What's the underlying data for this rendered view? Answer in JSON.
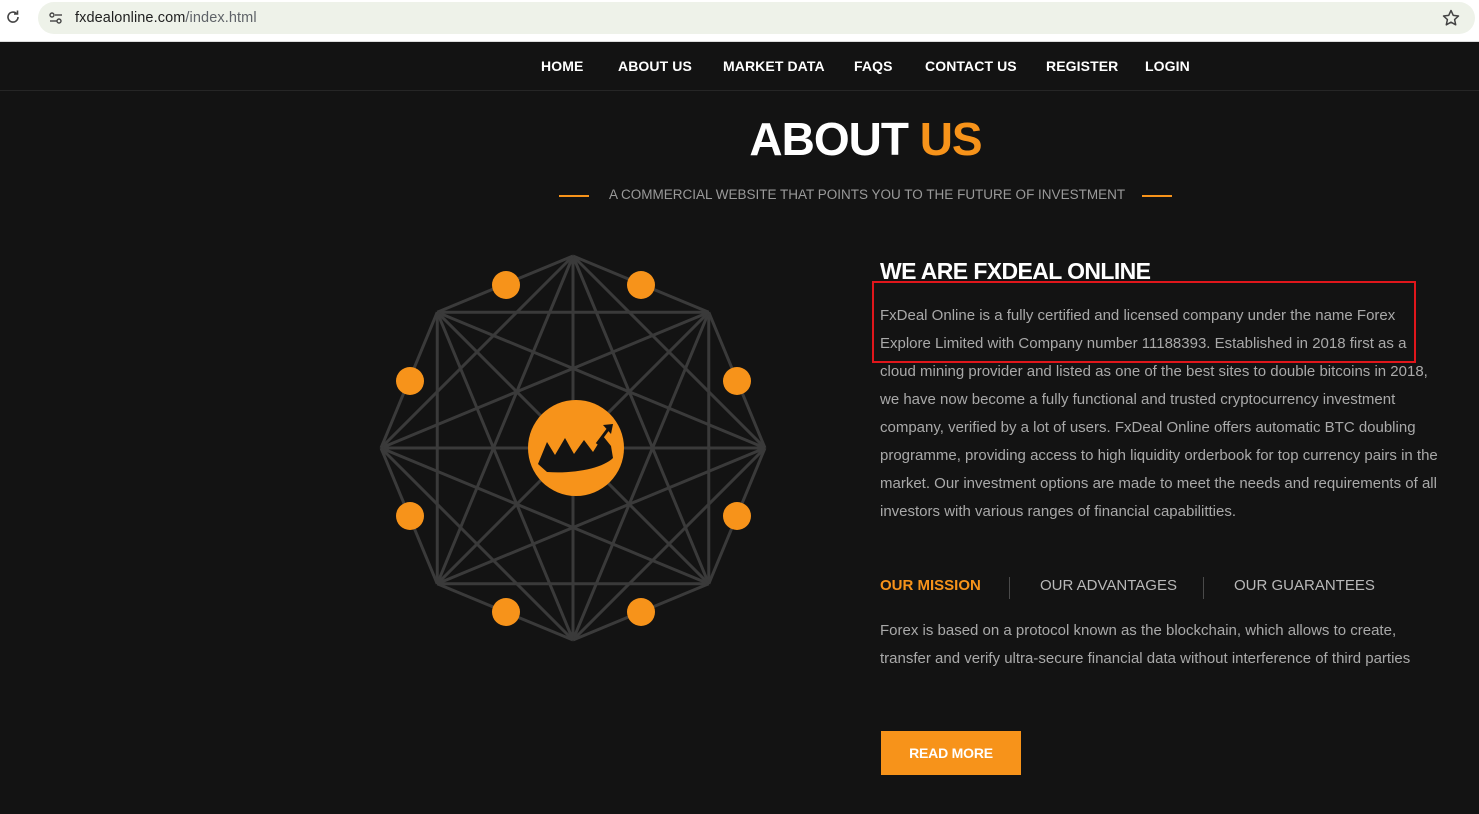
{
  "browser": {
    "url_domain": "fxdealonline.com",
    "url_path": "/index.html"
  },
  "nav": {
    "items": [
      "HOME",
      "ABOUT US",
      "MARKET DATA",
      "FAQS",
      "CONTACT US",
      "REGISTER",
      "LOGIN"
    ]
  },
  "hero": {
    "title_word1": "ABOUT",
    "title_word2": "US",
    "subtitle": "A COMMERCIAL WEBSITE THAT POINTS YOU TO THE FUTURE OF INVESTMENT"
  },
  "content": {
    "heading": "WE ARE FXDEAL ONLINE",
    "paragraph": "FxDeal Online is a fully certified and licensed company under the name Forex Explore Limited with Company number 11188393. Established in 2018 first as a cloud mining provider and listed as one of the best sites to double bitcoins in 2018, we have now become a fully functional and trusted cryptocurrency investment company, verified by a lot of users. FxDeal Online offers automatic BTC doubling programme, providing access to high liquidity orderbook for top currency pairs in the market. Our investment options are made to meet the needs and requirements of all investors with various ranges of financial capabilitties.",
    "tabs": [
      "OUR MISSION",
      "OUR ADVANTAGES",
      "OUR GUARANTEES"
    ],
    "tab_text": "Forex is based on a protocol known as the blockchain, which allows to create, transfer and verify ultra-secure financial data without interference of third parties",
    "button": "READ MORE"
  },
  "colors": {
    "accent": "#f7931a",
    "background": "#131313",
    "highlight": "#e0161b"
  }
}
